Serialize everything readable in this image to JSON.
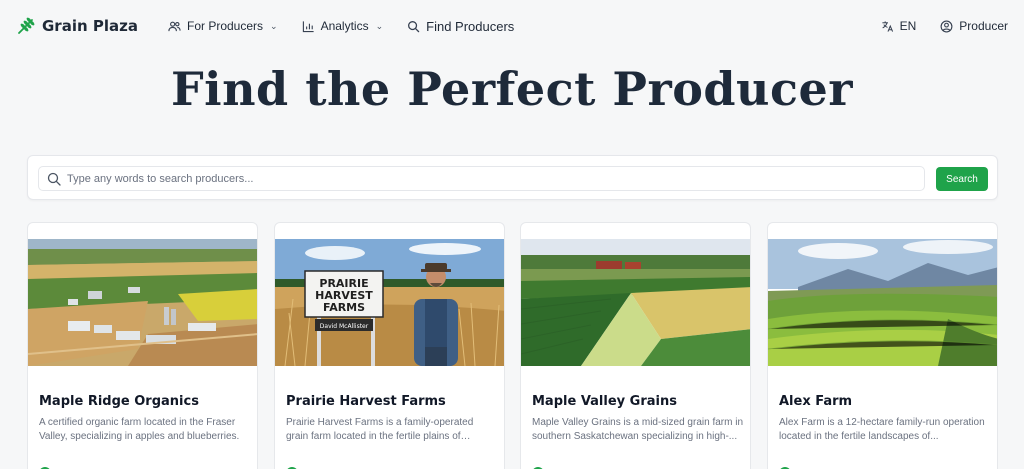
{
  "brand": {
    "name": "Grain Plaza",
    "logo_icon": "wheat-logo-icon",
    "accent": "#1fa34a"
  },
  "nav": {
    "for_producers": "For Producers",
    "analytics": "Analytics",
    "find_producers": "Find Producers",
    "language": "EN",
    "account": "Producer"
  },
  "hero": {
    "title": "Find the Perfect Producer"
  },
  "search": {
    "placeholder": "Type any words to search producers...",
    "value": "",
    "button_label": "Search"
  },
  "producers": [
    {
      "name": "Maple Ridge Organics",
      "description": "A certified organic farm located in the Fraser Valley, specializing in apples and blueberries.",
      "image": "aerial-farm-photo"
    },
    {
      "name": "Prairie Harvest Farms",
      "description": "Prairie Harvest Farms is a family-operated grain farm located in the fertile plains of Manitoba....",
      "image": "farmer-with-sign-photo",
      "sign_text": [
        "PRAIRIE",
        "HARVEST",
        "FARMS"
      ],
      "sign_caption": "David McAllister"
    },
    {
      "name": "Maple Valley Grains",
      "description": "Maple Valley Grains is a mid-sized grain farm in southern Saskatchewan specializing in high-...",
      "image": "crop-fields-photo"
    },
    {
      "name": "Alex Farm",
      "description": "Alex Farm is a 12-hectare family-run operation located in the fertile landscapes of...",
      "image": "green-hills-photo"
    }
  ]
}
